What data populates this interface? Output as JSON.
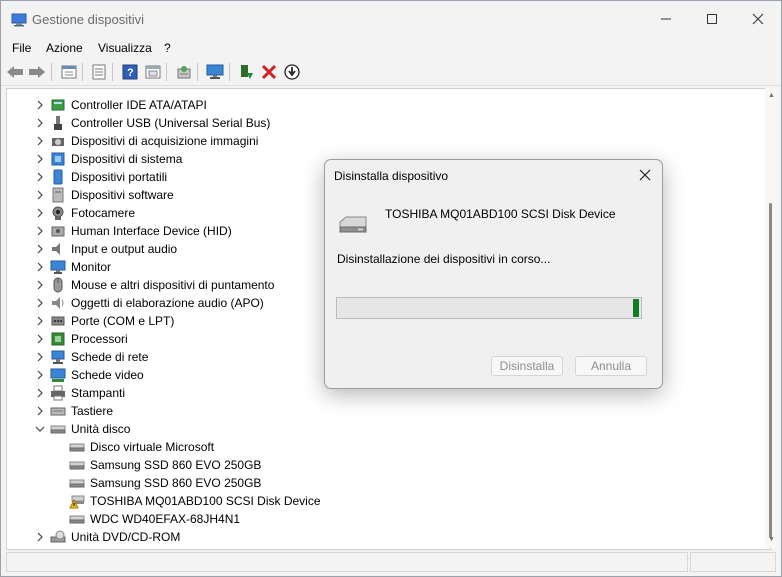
{
  "window": {
    "title": "Gestione dispositivi",
    "controls": {
      "minimize": "minimize-icon",
      "maximize": "maximize-icon",
      "close": "close-icon"
    }
  },
  "menu": [
    "File",
    "Azione",
    "Visualizza",
    "?"
  ],
  "toolbar": {
    "buttons": [
      "back-icon",
      "forward-icon",
      "properties-icon",
      "list-view-icon",
      "help-icon",
      "panel-icon",
      "scan-hardware-icon",
      "monitor-icon",
      "update-driver-icon",
      "uninstall-icon",
      "download-icon"
    ],
    "accent_red": "#d22020",
    "accent_green": "#1a8a3a"
  },
  "tree": {
    "categories": [
      {
        "label": "Controller IDE ATA/ATAPI",
        "icon": "ide-controller-icon",
        "expanded": false
      },
      {
        "label": "Controller USB (Universal Serial Bus)",
        "icon": "usb-icon",
        "expanded": false
      },
      {
        "label": "Dispositivi di acquisizione immagini",
        "icon": "camera-device-icon",
        "expanded": false
      },
      {
        "label": "Dispositivi di sistema",
        "icon": "system-device-icon",
        "expanded": false
      },
      {
        "label": "Dispositivi portatili",
        "icon": "portable-device-icon",
        "expanded": false
      },
      {
        "label": "Dispositivi software",
        "icon": "software-device-icon",
        "expanded": false
      },
      {
        "label": "Fotocamere",
        "icon": "webcam-icon",
        "expanded": false
      },
      {
        "label": "Human Interface Device (HID)",
        "icon": "hid-icon",
        "expanded": false
      },
      {
        "label": "Input e output audio",
        "icon": "speaker-icon",
        "expanded": false
      },
      {
        "label": "Monitor",
        "icon": "monitor-icon",
        "expanded": false
      },
      {
        "label": "Mouse e altri dispositivi di puntamento",
        "icon": "mouse-icon",
        "expanded": false
      },
      {
        "label": "Oggetti di elaborazione audio (APO)",
        "icon": "audio-apo-icon",
        "expanded": false
      },
      {
        "label": "Porte (COM e LPT)",
        "icon": "port-icon",
        "expanded": false
      },
      {
        "label": "Processori",
        "icon": "processor-icon",
        "expanded": false
      },
      {
        "label": "Schede di rete",
        "icon": "network-adapter-icon",
        "expanded": false
      },
      {
        "label": "Schede video",
        "icon": "display-adapter-icon",
        "expanded": false
      },
      {
        "label": "Stampanti",
        "icon": "printer-icon",
        "expanded": false
      },
      {
        "label": "Tastiere",
        "icon": "keyboard-icon",
        "expanded": false
      },
      {
        "label": "Unità disco",
        "icon": "disk-drive-icon",
        "expanded": true
      },
      {
        "label": "Unità DVD/CD-ROM",
        "icon": "dvd-icon",
        "expanded": false
      }
    ],
    "disk_children": [
      {
        "label": "Disco virtuale Microsoft",
        "icon": "disk-drive-icon",
        "warning": false
      },
      {
        "label": "Samsung SSD 860 EVO 250GB",
        "icon": "disk-drive-icon",
        "warning": false
      },
      {
        "label": "Samsung SSD 860 EVO 250GB",
        "icon": "disk-drive-icon",
        "warning": false
      },
      {
        "label": "TOSHIBA MQ01ABD100 SCSI Disk Device",
        "icon": "warning-icon",
        "warning": true
      },
      {
        "label": "WDC WD40EFAX-68JH4N1",
        "icon": "disk-drive-icon",
        "warning": false
      }
    ]
  },
  "dialog": {
    "title": "Disinstalla dispositivo",
    "device_name": "TOSHIBA MQ01ABD100 SCSI Disk Device",
    "status": "Disinstallazione dei dispositivi in corso...",
    "progress": 0.02,
    "progress_color": "#0f7d24",
    "uninstall_label": "Disinstalla",
    "cancel_label": "Annulla"
  }
}
